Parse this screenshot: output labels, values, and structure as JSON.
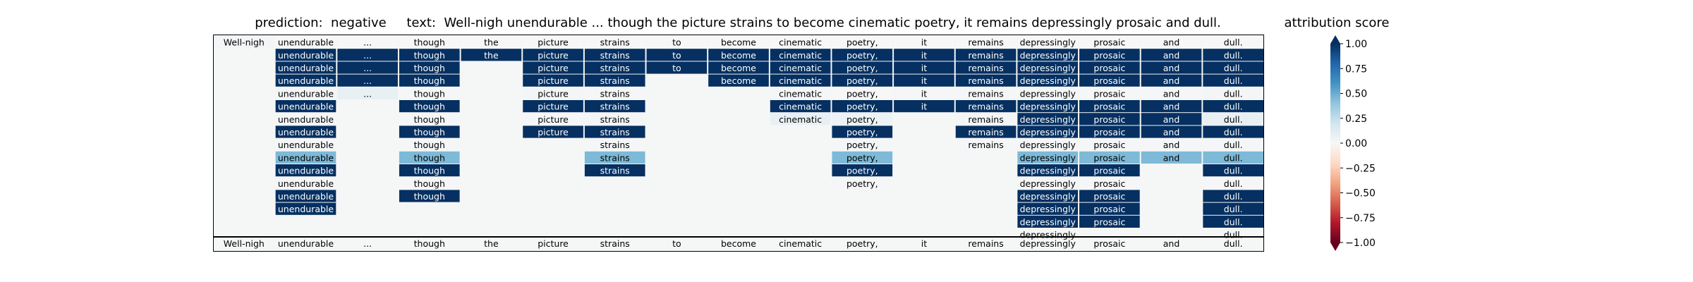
{
  "header": {
    "prediction_label": "prediction:",
    "prediction_value": "negative",
    "text_label": "text:",
    "text_value": "Well-nigh unendurable ... though the picture strains to become cinematic poetry, it remains depressingly prosaic and dull."
  },
  "colorbar": {
    "label": "attribution score",
    "ticks": [
      "1.00",
      "0.75",
      "0.50",
      "0.25",
      "0.00",
      "−0.25",
      "−0.50",
      "−0.75",
      "−1.00"
    ],
    "tick_values": [
      1.0,
      0.75,
      0.5,
      0.25,
      0.0,
      -0.25,
      -0.5,
      -0.75,
      -1.0
    ],
    "range": [
      -1,
      1
    ],
    "colormap": "RdBu"
  },
  "chart_data": {
    "type": "heatmap",
    "tokens": [
      "Well-nigh",
      "unendurable",
      "...",
      "though",
      "the",
      "picture",
      "strains",
      "to",
      "become",
      "cinematic",
      "poetry,",
      "it",
      "remains",
      "depressingly",
      "prosaic",
      "and",
      "dull."
    ],
    "rows": [
      [
        0.02,
        0.0,
        0.0,
        0.0,
        0,
        0,
        0,
        0,
        0,
        0,
        0,
        0,
        0,
        0,
        0,
        0,
        0
      ],
      [
        null,
        1,
        1,
        1,
        1,
        1,
        1,
        1,
        1,
        1,
        1,
        1,
        1,
        1,
        1,
        1,
        1
      ],
      [
        null,
        1,
        1,
        1,
        null,
        1,
        1,
        1,
        1,
        1,
        1,
        1,
        1,
        1,
        1,
        1,
        1
      ],
      [
        null,
        1,
        1,
        1,
        null,
        1,
        1,
        null,
        1,
        1,
        1,
        1,
        1,
        1,
        1,
        1,
        1
      ],
      [
        null,
        0.02,
        0.08,
        0.01,
        null,
        0.02,
        0.01,
        null,
        null,
        0.01,
        0.0,
        0.01,
        0.01,
        0.01,
        0.01,
        0.01,
        0.02
      ],
      [
        null,
        1,
        null,
        1,
        null,
        1,
        1,
        null,
        null,
        1,
        1,
        1,
        1,
        1,
        1,
        1,
        1
      ],
      [
        null,
        0.01,
        null,
        0.01,
        null,
        0.01,
        0.02,
        null,
        null,
        0.08,
        0.06,
        null,
        0.02,
        1,
        1,
        1,
        0.08
      ],
      [
        null,
        1,
        null,
        1,
        null,
        1,
        1,
        null,
        null,
        null,
        1,
        null,
        1,
        1,
        1,
        1,
        1
      ],
      [
        null,
        0.01,
        null,
        0.01,
        null,
        null,
        0.01,
        null,
        null,
        null,
        0.01,
        null,
        0.01,
        0.01,
        0.01,
        0.01,
        0.01
      ],
      [
        null,
        0.45,
        null,
        0.45,
        null,
        null,
        0.45,
        null,
        null,
        null,
        0.45,
        null,
        null,
        0.45,
        0.45,
        0.45,
        0.45
      ],
      [
        null,
        1,
        null,
        1,
        null,
        null,
        1,
        null,
        null,
        null,
        1,
        null,
        null,
        1,
        1,
        null,
        1
      ],
      [
        null,
        0.01,
        null,
        0.01,
        null,
        null,
        null,
        null,
        null,
        null,
        0.01,
        null,
        null,
        0.01,
        0.01,
        null,
        0.01
      ],
      [
        null,
        1,
        null,
        1,
        null,
        null,
        null,
        null,
        null,
        null,
        null,
        null,
        null,
        1,
        1,
        null,
        1
      ],
      [
        null,
        1,
        null,
        null,
        null,
        null,
        null,
        null,
        null,
        null,
        null,
        null,
        null,
        1,
        1,
        null,
        1
      ],
      [
        null,
        null,
        null,
        null,
        null,
        null,
        null,
        null,
        null,
        null,
        null,
        null,
        null,
        1,
        1,
        null,
        1
      ],
      [
        null,
        null,
        null,
        null,
        null,
        null,
        null,
        null,
        null,
        null,
        null,
        null,
        null,
        0.01,
        null,
        null,
        0.01
      ]
    ],
    "footer_row": [
      "Well-nigh",
      "unendurable",
      "...",
      "though",
      "the",
      "picture",
      "strains",
      "to",
      "become",
      "cinematic",
      "poetry,",
      "it",
      "remains",
      "depressingly",
      "prosaic",
      "and",
      "dull."
    ]
  }
}
